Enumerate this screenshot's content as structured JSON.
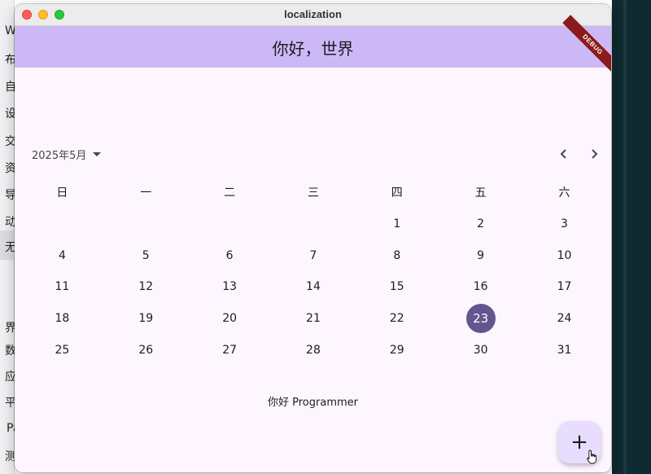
{
  "window": {
    "title": "localization"
  },
  "appbar": {
    "title": "你好，世界",
    "debug_banner": "DEBUG"
  },
  "calendar": {
    "month_label": "2025年5月",
    "weekdays": [
      "日",
      "一",
      "二",
      "三",
      "四",
      "五",
      "六"
    ],
    "weeks": [
      [
        "",
        "",
        "",
        "",
        "1",
        "2",
        "3"
      ],
      [
        "4",
        "5",
        "6",
        "7",
        "8",
        "9",
        "10"
      ],
      [
        "11",
        "12",
        "13",
        "14",
        "15",
        "16",
        "17"
      ],
      [
        "18",
        "19",
        "20",
        "21",
        "22",
        "23",
        "24"
      ],
      [
        "25",
        "26",
        "27",
        "28",
        "29",
        "30",
        "31"
      ]
    ],
    "selected_day": "23",
    "prev_icon": "chevron-left-icon",
    "next_icon": "chevron-right-icon"
  },
  "greeting": "你好 Programmer",
  "fab": {
    "label": "+",
    "icon": "plus-icon"
  },
  "background": {
    "left_chars": [
      "W",
      "布",
      "自",
      "设",
      "交",
      "资",
      "导",
      "动",
      "无",
      "界",
      "数",
      "应",
      "平",
      "Pa",
      "测"
    ]
  },
  "colors": {
    "appbar": "#cdb8f7",
    "surface": "#fdf6fe",
    "selected": "#65558f",
    "fab": "#e8ddff"
  }
}
